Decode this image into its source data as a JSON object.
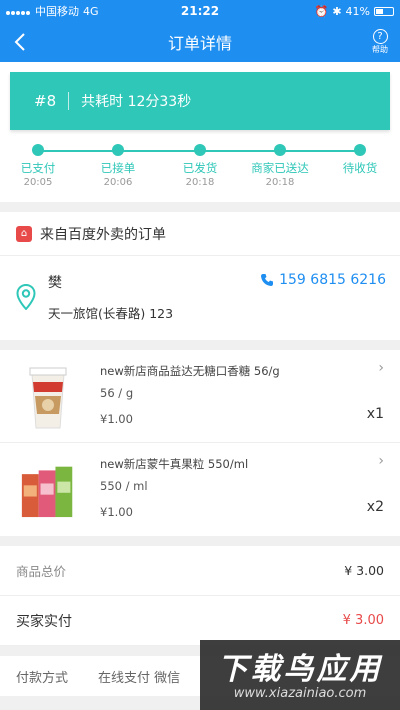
{
  "status_bar": {
    "carrier": "中国移动",
    "network": "4G",
    "time": "21:22",
    "battery": "41%"
  },
  "nav": {
    "title": "订单详情",
    "help_label": "帮助"
  },
  "order": {
    "number": "#8",
    "duration": "共耗时 12分33秒"
  },
  "timeline": {
    "steps": [
      {
        "label": "已支付",
        "time": "20:05"
      },
      {
        "label": "已接单",
        "time": "20:06"
      },
      {
        "label": "已发货",
        "time": "20:18"
      },
      {
        "label": "商家已送达",
        "time": "20:18"
      },
      {
        "label": "待收货",
        "time": ""
      }
    ]
  },
  "source": {
    "text": "来自百度外卖的订单"
  },
  "address": {
    "name": "樊",
    "line": "天一旅馆(长春路) 123",
    "phone": "159 6815 6216"
  },
  "products": [
    {
      "name": "new新店商品益达无糖口香糖 56/g",
      "spec": "56 / g",
      "price": "¥1.00",
      "qty": "x1"
    },
    {
      "name": "new新店蒙牛真果粒 550/ml",
      "spec": "550 / ml",
      "price": "¥1.00",
      "qty": "x2"
    }
  ],
  "summary": {
    "total_label": "商品总价",
    "total_value": "¥ 3.00",
    "paid_label": "买家实付",
    "paid_value": "¥ 3.00"
  },
  "payment": {
    "label": "付款方式",
    "methods": "在线支付  微信"
  },
  "watermark": {
    "main": "下载鸟应用",
    "sub": "www.xiazainiao.com"
  },
  "colors": {
    "primary": "#1f8ef1",
    "accent": "#2fc7b8",
    "price_red": "#e84a4a"
  }
}
